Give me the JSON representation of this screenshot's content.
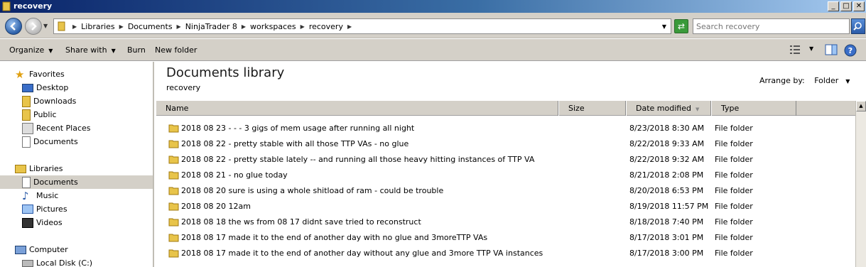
{
  "window": {
    "title": "recovery",
    "minimize": "_",
    "maximize": "□",
    "close": "✕"
  },
  "address": {
    "crumbs": [
      "Libraries",
      "Documents",
      "NinjaTrader 8",
      "workspaces",
      "recovery"
    ]
  },
  "search": {
    "placeholder": "Search recovery"
  },
  "toolbar": {
    "organize": "Organize",
    "share_with": "Share with",
    "burn": "Burn",
    "new_folder": "New folder"
  },
  "nav": {
    "favorites": "Favorites",
    "desktop": "Desktop",
    "downloads": "Downloads",
    "public": "Public",
    "recent_places": "Recent Places",
    "documents_fav": "Documents",
    "libraries": "Libraries",
    "documents": "Documents",
    "music": "Music",
    "pictures": "Pictures",
    "videos": "Videos",
    "computer": "Computer",
    "local_disk": "Local Disk (C:)"
  },
  "library": {
    "title": "Documents library",
    "subtitle": "recovery",
    "arrange_label": "Arrange by:",
    "arrange_value": "Folder"
  },
  "columns": {
    "name": "Name",
    "size": "Size",
    "date": "Date modified",
    "type": "Type"
  },
  "files": [
    {
      "name": "2018 08 23 - - - 3 gigs of mem usage after running all night",
      "date": "8/23/2018 8:30 AM",
      "type": "File folder"
    },
    {
      "name": "2018 08 22 - pretty stable with all those TTP VAs - no glue",
      "date": "8/22/2018 9:33 AM",
      "type": "File folder"
    },
    {
      "name": "2018 08 22 - pretty stable lately -- and running all those heavy hitting instances of TTP VA",
      "date": "8/22/2018 9:32 AM",
      "type": "File folder"
    },
    {
      "name": "2018 08 21 - no glue today",
      "date": "8/21/2018 2:08 PM",
      "type": "File folder"
    },
    {
      "name": "2018 08 20 sure is using a whole shitload of ram - could be trouble",
      "date": "8/20/2018 6:53 PM",
      "type": "File folder"
    },
    {
      "name": "2018 08 20 12am",
      "date": "8/19/2018 11:57 PM",
      "type": "File folder"
    },
    {
      "name": "2018 08 18 the ws from 08 17 didnt save tried to reconstruct",
      "date": "8/18/2018 7:40 PM",
      "type": "File folder"
    },
    {
      "name": "2018 08 17 made it to the end of another day with no glue and 3moreTTP VAs",
      "date": "8/17/2018 3:01 PM",
      "type": "File folder"
    },
    {
      "name": "2018 08 17 made it to the end of another day without any glue and 3more TTP VA instances",
      "date": "8/17/2018 3:00 PM",
      "type": "File folder"
    }
  ]
}
